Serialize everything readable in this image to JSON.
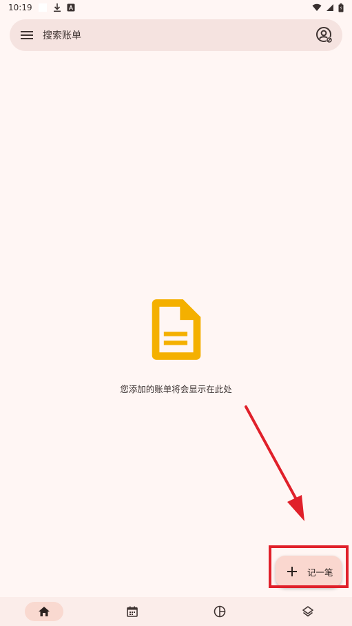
{
  "status_bar": {
    "time": "10:19",
    "icons": [
      "white-square-icon",
      "download-icon",
      "app-a-icon",
      "wifi-icon",
      "signal-icon",
      "battery-icon"
    ]
  },
  "search": {
    "placeholder": "搜索账单",
    "menu_icon": "menu-icon",
    "profile_icon": "account-circle-icon"
  },
  "empty_state": {
    "icon": "document-icon",
    "icon_color": "#F4B000",
    "message": "您添加的账单将会显示在此处"
  },
  "fab": {
    "icon": "plus-icon",
    "label": "记一笔"
  },
  "annotation": {
    "color": "#E0202A"
  },
  "bottom_nav": {
    "items": [
      {
        "icon": "home-icon",
        "active": true
      },
      {
        "icon": "calendar-icon",
        "active": false
      },
      {
        "icon": "pie-chart-icon",
        "active": false
      },
      {
        "icon": "layers-icon",
        "active": false
      }
    ]
  }
}
